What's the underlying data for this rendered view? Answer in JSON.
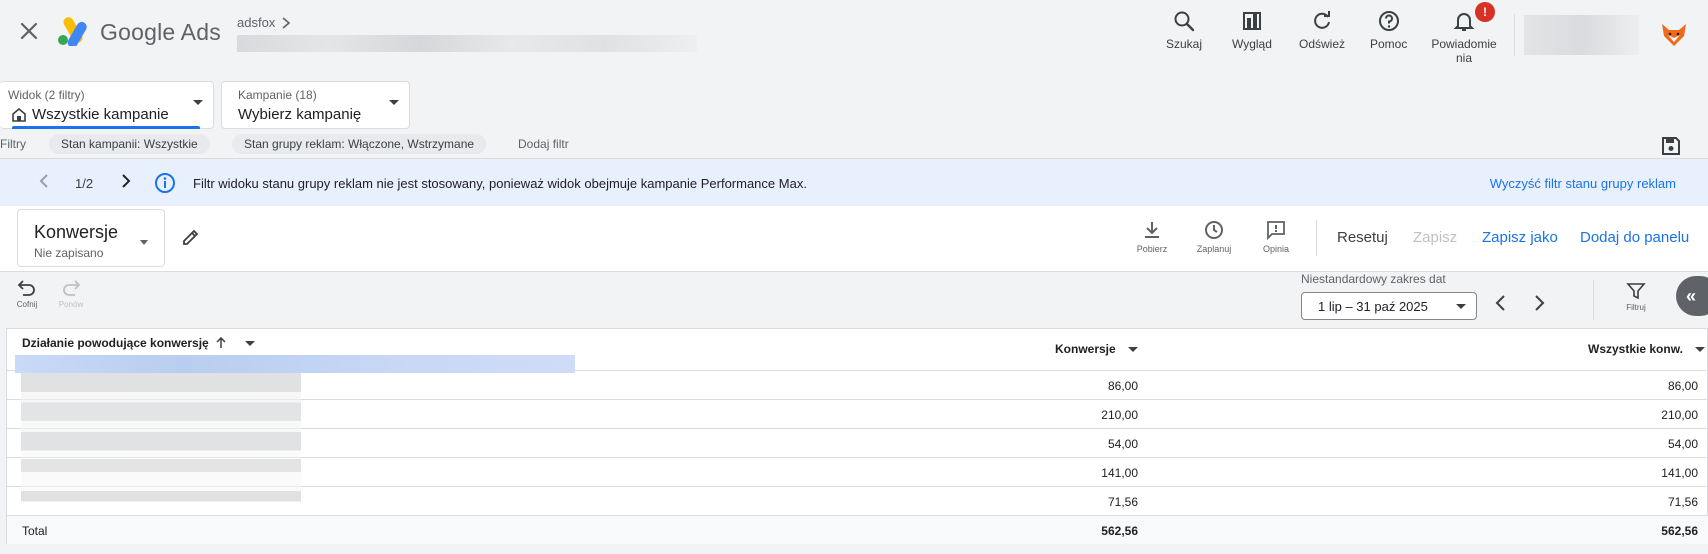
{
  "topbar": {
    "brand": "Google Ads",
    "account": "adsfox",
    "tools": [
      {
        "label": "Szukaj",
        "icon": "search-icon"
      },
      {
        "label": "Wygląd",
        "icon": "appearance-icon"
      },
      {
        "label": "Odśwież",
        "icon": "refresh-icon"
      },
      {
        "label": "Pomoc",
        "icon": "help-icon"
      },
      {
        "label1": "Powiadomie",
        "label2": "nia",
        "icon": "bell-icon",
        "badge": "!"
      }
    ]
  },
  "view_filter": {
    "label": "Widok (2 filtry)",
    "value": "Wszystkie kampanie"
  },
  "campaign_filter": {
    "label": "Kampanie (18)",
    "value": "Wybierz kampanię"
  },
  "filters": {
    "label": "Filtry",
    "chips": [
      "Stan kampanii: Wszystkie",
      "Stan grupy reklam: Włączone, Wstrzymane"
    ],
    "add": "Dodaj filtr"
  },
  "banner": {
    "page": "1/2",
    "message": "Filtr widoku stanu grupy reklam nie jest stosowany, ponieważ widok obejmuje kampanie Performance Max.",
    "action": "Wyczyść filtr stanu grupy reklam"
  },
  "report": {
    "name": "Konwersje",
    "status": "Nie zapisano",
    "tools": [
      "Pobierz",
      "Zaplanuj",
      "Opinia"
    ],
    "reset": "Resetuj",
    "save": "Zapisz",
    "save_as": "Zapisz jako",
    "add_to_panel": "Dodaj do panelu"
  },
  "toolbar": {
    "undo": "Cofnij",
    "redo": "Ponów",
    "date_label": "Niestandardowy zakres dat",
    "date_value": "1 lip – 31 paź 2025",
    "filter": "Filtruj"
  },
  "table": {
    "columns": [
      "Działanie powodujące konwersję",
      "Konwersje",
      "Wszystkie konw."
    ],
    "rows": [
      {
        "conversions": "86,00",
        "all_conversions": "86,00"
      },
      {
        "conversions": "210,00",
        "all_conversions": "210,00"
      },
      {
        "conversions": "54,00",
        "all_conversions": "54,00"
      },
      {
        "conversions": "141,00",
        "all_conversions": "141,00"
      },
      {
        "conversions": "71,56",
        "all_conversions": "71,56"
      }
    ],
    "total": {
      "label": "Total",
      "conversions": "562,56",
      "all_conversions": "562,56"
    }
  },
  "colors": {
    "accent": "#1a73e8",
    "banner_bg": "#e8f0fe",
    "badge": "#d93025"
  }
}
